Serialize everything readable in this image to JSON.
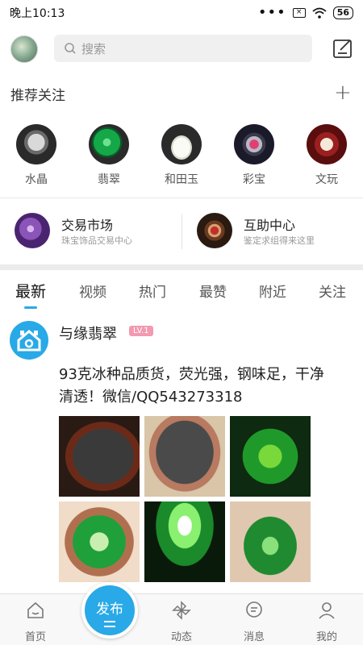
{
  "status_bar": {
    "time": "晚上10:13",
    "signal_dots": "•••",
    "sim_icon": "sim-blocked-icon",
    "battery": "56"
  },
  "top_bar": {
    "search_placeholder": "搜索",
    "avatar_icon": "user-avatar",
    "compose_icon": "compose-icon"
  },
  "recommend": {
    "title": "推荐关注",
    "add_icon": "plus-icon"
  },
  "categories": [
    {
      "label": "水晶",
      "icon": "crystal-buddha-image",
      "color": "#3a3a3a"
    },
    {
      "label": "翡翠",
      "icon": "jadeite-image",
      "color": "#0f8a3a"
    },
    {
      "label": "和田玉",
      "icon": "hetian-jade-image",
      "color": "#efefe6"
    },
    {
      "label": "彩宝",
      "icon": "gemstone-ring-image",
      "color": "#c0305a"
    },
    {
      "label": "文玩",
      "icon": "bead-bracelet-image",
      "color": "#8a1e1e"
    }
  ],
  "features": [
    {
      "title": "交易市场",
      "subtitle": "珠宝饰品交易中心",
      "icon": "amethyst-image"
    },
    {
      "title": "互助中心",
      "subtitle": "鉴定求组得来这里",
      "icon": "ruby-ring-image"
    }
  ],
  "tabs": [
    "最新",
    "视频",
    "热门",
    "最赞",
    "附近",
    "关注"
  ],
  "active_tab": "最新",
  "post": {
    "username": "与缘翡翠",
    "level": "LV.1",
    "text": "93克冰种品质货，荧光强，钢味足，干净清透！微信/QQ543273318",
    "avatar_icon": "shop-avatar-icon"
  },
  "bottom_nav": {
    "items": [
      {
        "label": "首页",
        "icon": "home-icon"
      },
      {
        "label": "发布",
        "icon": "publish-icon"
      },
      {
        "label": "动态",
        "icon": "pinwheel-icon"
      },
      {
        "label": "消息",
        "icon": "message-icon"
      },
      {
        "label": "我的",
        "icon": "profile-icon"
      }
    ]
  },
  "colors": {
    "accent": "#29a9e7",
    "level_badge": "#f29ab0"
  }
}
